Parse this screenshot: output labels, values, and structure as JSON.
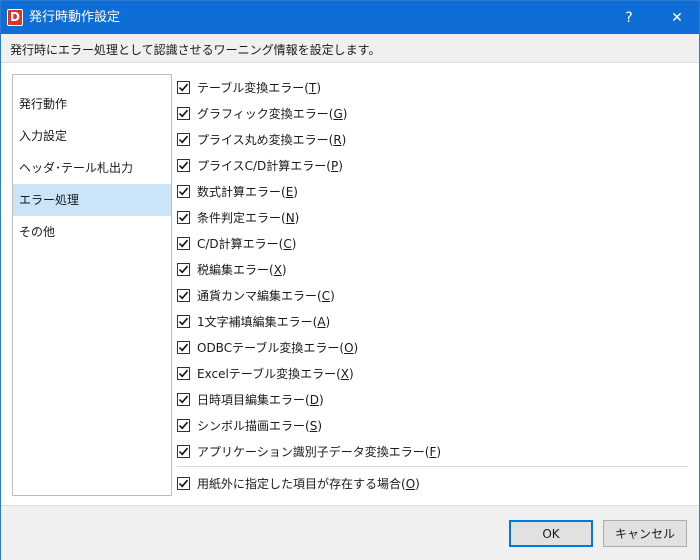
{
  "window": {
    "title": "発行時動作設定",
    "app_icon_letter": "D",
    "help_label": "?",
    "close_label": "✕"
  },
  "description": "発行時にエラー処理として認識させるワーニング情報を設定します。",
  "sidebar": {
    "items": [
      {
        "label": "発行動作",
        "selected": false
      },
      {
        "label": "入力設定",
        "selected": false
      },
      {
        "label": "ヘッダ･テール札出力",
        "selected": false
      },
      {
        "label": "エラー処理",
        "selected": true
      },
      {
        "label": "その他",
        "selected": false
      }
    ]
  },
  "options": [
    {
      "label": "テーブル変換エラー(",
      "key": "T",
      "suffix": ")",
      "checked": true
    },
    {
      "label": "グラフィック変換エラー(",
      "key": "G",
      "suffix": ")",
      "checked": true
    },
    {
      "label": "プライス丸め変換エラー(",
      "key": "R",
      "suffix": ")",
      "checked": true
    },
    {
      "label": "プライスC/D計算エラー(",
      "key": "P",
      "suffix": ")",
      "checked": true
    },
    {
      "label": "数式計算エラー(",
      "key": "E",
      "suffix": ")",
      "checked": true
    },
    {
      "label": "条件判定エラー(",
      "key": "N",
      "suffix": ")",
      "checked": true
    },
    {
      "label": "C/D計算エラー(",
      "key": "C",
      "suffix": ")",
      "checked": true
    },
    {
      "label": "税編集エラー(",
      "key": "X",
      "suffix": ")",
      "checked": true
    },
    {
      "label": "通貨カンマ編集エラー(",
      "key": "C",
      "suffix": ")",
      "checked": true
    },
    {
      "label": "1文字補填編集エラー(",
      "key": "A",
      "suffix": ")",
      "checked": true
    },
    {
      "label": "ODBCテーブル変換エラー(",
      "key": "O",
      "suffix": ")",
      "checked": true
    },
    {
      "label": "Excelテーブル変換エラー(",
      "key": "X",
      "suffix": ")",
      "checked": true
    },
    {
      "label": "日時項目編集エラー(",
      "key": "D",
      "suffix": ")",
      "checked": true
    },
    {
      "label": "シンボル描画エラー(",
      "key": "S",
      "suffix": ")",
      "checked": true
    },
    {
      "label": "アプリケーション識別子データ変換エラー(",
      "key": "F",
      "suffix": ")",
      "checked": true
    }
  ],
  "extra_option": {
    "label": "用紙外に指定した項目が存在する場合(",
    "key": "O",
    "suffix": ")",
    "checked": true
  },
  "footer": {
    "ok_label": "OK",
    "cancel_label": "キャンセル"
  },
  "colors": {
    "titlebar": "#0f6ed6",
    "selection": "#cce4f7",
    "primary_border": "#0078d7"
  }
}
